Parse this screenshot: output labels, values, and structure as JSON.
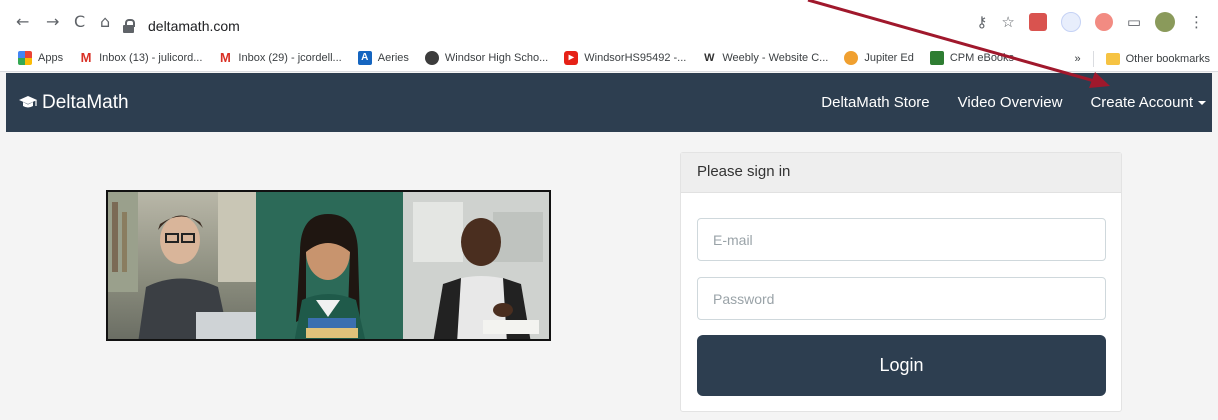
{
  "browser": {
    "url": "deltamath.com",
    "nav": {
      "back": "←",
      "forward": "→",
      "reload": "C",
      "home": "⌂"
    },
    "bookmarks": [
      {
        "label": "Apps",
        "icon": "apps-grid-icon"
      },
      {
        "label": "Inbox (13) - julicord...",
        "icon": "gmail-icon"
      },
      {
        "label": "Inbox (29) - jcordell...",
        "icon": "gmail-icon"
      },
      {
        "label": "Aeries",
        "icon": "aeries-icon"
      },
      {
        "label": "Windsor High Scho...",
        "icon": "windsor-icon"
      },
      {
        "label": "WindsorHS95492 -...",
        "icon": "youtube-icon"
      },
      {
        "label": "Weebly - Website C...",
        "icon": "weebly-icon"
      },
      {
        "label": "Jupiter Ed",
        "icon": "jupiter-icon"
      },
      {
        "label": "CPM eBooks",
        "icon": "cpm-icon"
      }
    ],
    "overflow": "»",
    "other_bookmarks": "Other bookmarks"
  },
  "site": {
    "brand": "DeltaMath",
    "nav": [
      "DeltaMath Store",
      "Video Overview",
      "Create Account"
    ]
  },
  "signin": {
    "title": "Please sign in",
    "email_placeholder": "E-mail",
    "password_placeholder": "Password",
    "login_label": "Login"
  },
  "colors": {
    "navbar": "#2d3e50",
    "annotation_arrow": "#a0182c",
    "page_bg": "#f4f4f4"
  }
}
